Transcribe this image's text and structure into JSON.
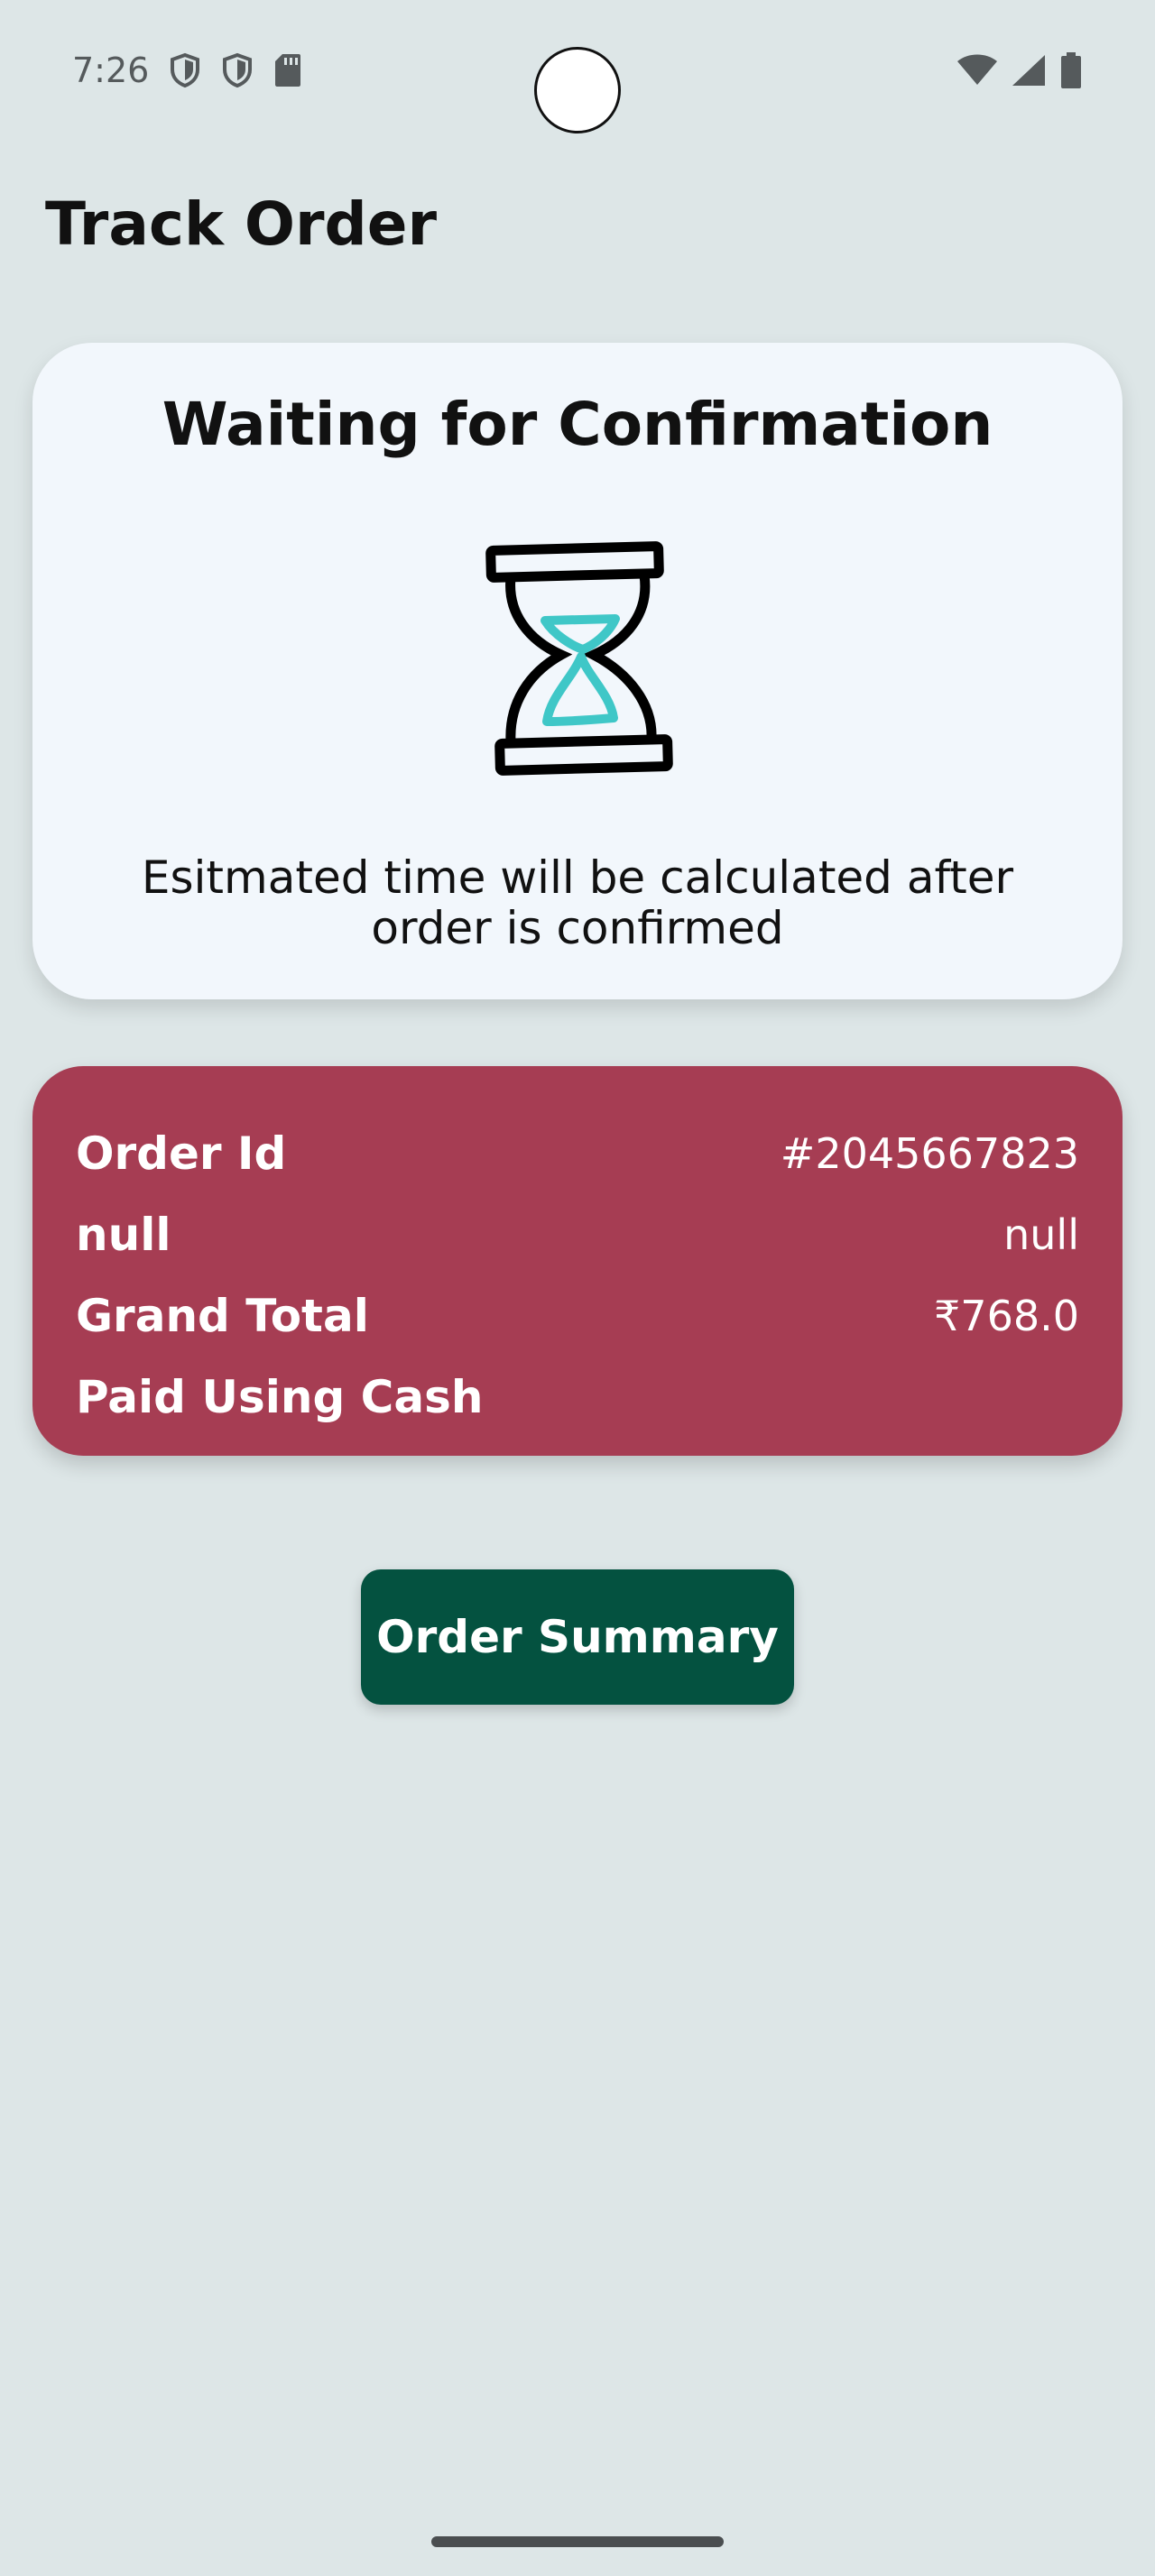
{
  "status_bar": {
    "time": "7:26",
    "left_icons": [
      "shield-icon",
      "shield-icon",
      "sd-card-icon"
    ],
    "right_icons": [
      "wifi-icon",
      "signal-icon",
      "battery-icon"
    ]
  },
  "header": {
    "title": "Track Order"
  },
  "status_card": {
    "title": "Waiting for Confirmation",
    "icon": "hourglass-icon",
    "message": "Esitmated time will be calculated after order is confirmed"
  },
  "order_card": {
    "rows": [
      {
        "label": "Order Id",
        "value": "#2045667823"
      },
      {
        "label": "null",
        "value": "null"
      },
      {
        "label": "Grand Total",
        "value": "₹768.0"
      },
      {
        "label": "Paid Using Cash",
        "value": ""
      }
    ]
  },
  "actions": {
    "order_summary_label": "Order Summary"
  },
  "colors": {
    "background": "#dde6e7",
    "status_card": "#f2f7fc",
    "order_card": "#a63d53",
    "button": "#045240",
    "hourglass_sand": "#3fc7c7"
  }
}
